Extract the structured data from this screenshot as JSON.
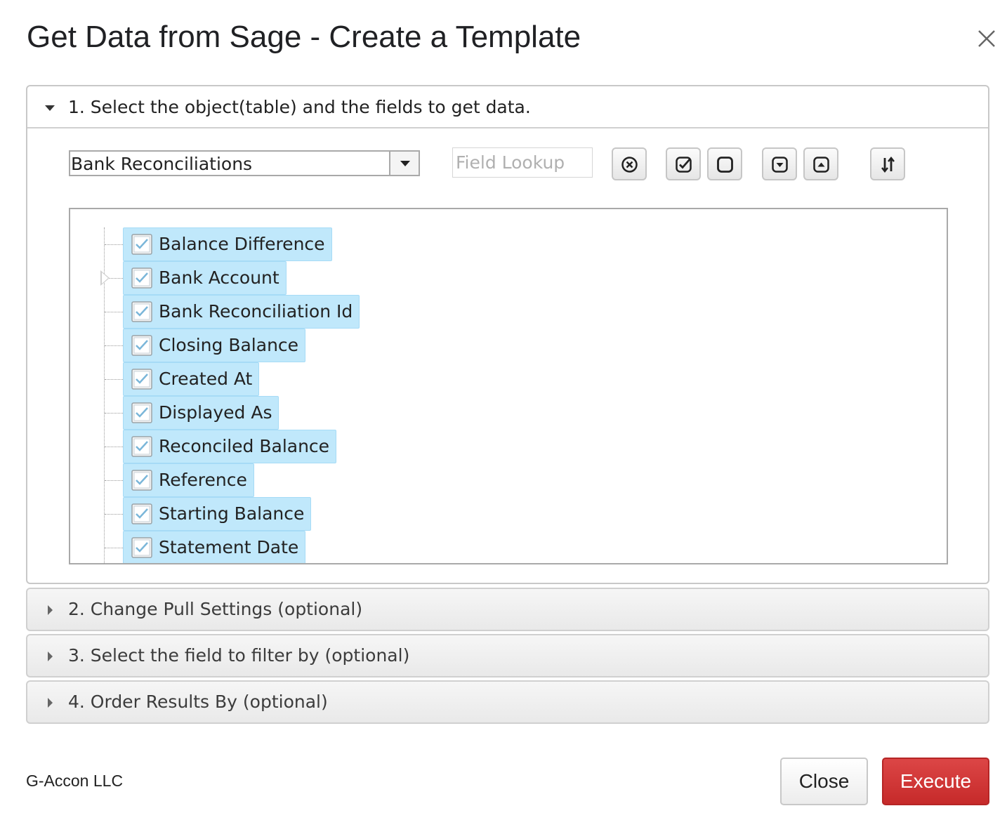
{
  "dialog": {
    "title": "Get Data from Sage - Create a Template",
    "close_icon": "close-x-icon"
  },
  "section1": {
    "label": "1. Select the object(table) and the fields to get data.",
    "expanded": true,
    "object_select": {
      "value": "Bank Reconciliations"
    },
    "field_lookup": {
      "placeholder": "Field Lookup",
      "value": ""
    },
    "toolbar_icons": [
      "clear-circle-x-icon",
      "check-all-icon",
      "uncheck-all-icon",
      "expand-all-icon",
      "collapse-all-icon",
      "sort-icon"
    ],
    "fields": [
      {
        "label": "Balance Difference",
        "checked": true,
        "expandable": false
      },
      {
        "label": "Bank Account",
        "checked": true,
        "expandable": true
      },
      {
        "label": "Bank Reconciliation Id",
        "checked": true,
        "expandable": false
      },
      {
        "label": "Closing Balance",
        "checked": true,
        "expandable": false
      },
      {
        "label": "Created At",
        "checked": true,
        "expandable": false
      },
      {
        "label": "Displayed As",
        "checked": true,
        "expandable": false
      },
      {
        "label": "Reconciled Balance",
        "checked": true,
        "expandable": false
      },
      {
        "label": "Reference",
        "checked": true,
        "expandable": false
      },
      {
        "label": "Starting Balance",
        "checked": true,
        "expandable": false
      },
      {
        "label": "Statement Date",
        "checked": true,
        "expandable": false
      }
    ]
  },
  "section2": {
    "label": "2. Change Pull Settings (optional)",
    "expanded": false
  },
  "section3": {
    "label": "3. Select the field to filter by (optional)",
    "expanded": false
  },
  "section4": {
    "label": "4. Order Results By (optional)",
    "expanded": false
  },
  "footer": {
    "brand": "G-Accon LLC",
    "close_label": "Close",
    "execute_label": "Execute"
  },
  "colors": {
    "execute_button": "#c62a2a",
    "selected_node": "#c0e8fb",
    "panel_border": "#c8c8c8"
  }
}
